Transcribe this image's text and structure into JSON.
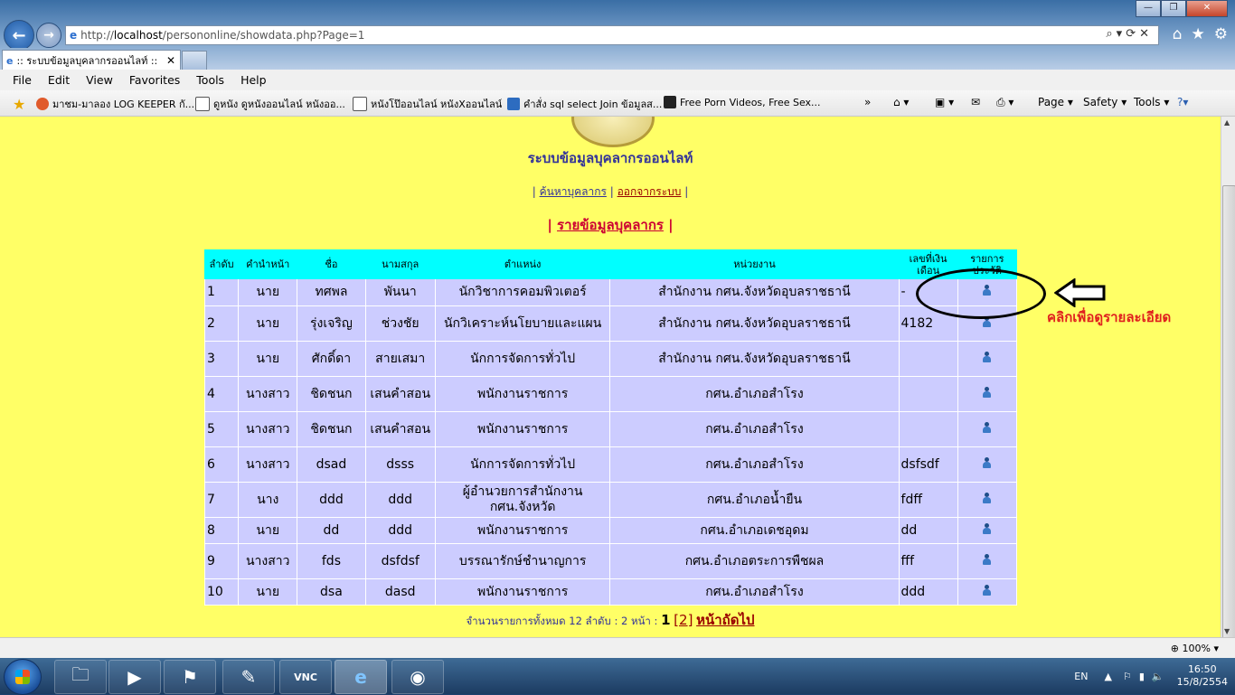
{
  "browser": {
    "url_prefix": "http://",
    "url_host": "localhost",
    "url_path": "/persononline/showdata.php?Page=1",
    "tab_title": ":: ระบบข้อมูลบุคลากรออนไลท์ ::",
    "menu": [
      "File",
      "Edit",
      "View",
      "Favorites",
      "Tools",
      "Help"
    ],
    "favorites": [
      "มาชม-มาลอง LOG KEEPER กั...",
      "ดูหนัง ดูหนังออนไลน์ หนังออ...",
      "หนังโป๊ออนไลน์ หนังXออนไลน์",
      "คำสั่ง sql select Join ข้อมูลส...",
      "Free Porn Videos, Free Sex..."
    ],
    "commands": {
      "page": "Page",
      "safety": "Safety",
      "tools": "Tools"
    },
    "zoom": "100%"
  },
  "page": {
    "site_title": "ระบบข้อมูลบุคลากรออนไลท์",
    "nav_search": "ค้นหาบุคลากร",
    "nav_logout": "ออกจากระบบ",
    "section_title": "รายข้อมูลบุคลากร",
    "table": {
      "headers": [
        "ลำดับ",
        "คำนำหน้า",
        "ชื่อ",
        "นามสกุล",
        "ตำแหน่ง",
        "หน่วยงาน",
        "เลขที่เงินเดือน",
        "รายการประวัติ"
      ],
      "rows": [
        [
          "1",
          "นาย",
          "ทศพล",
          "พันนา",
          "นักวิชาการคอมพิวเตอร์",
          "สำนักงาน กศน.จังหวัดอุบลราชธานี",
          "-"
        ],
        [
          "2",
          "นาย",
          "รุ่งเจริญ",
          "ช่วงชัย",
          "นักวิเคราะห์นโยบายและแผน",
          "สำนักงาน กศน.จังหวัดอุบลราชธานี",
          "4182"
        ],
        [
          "3",
          "นาย",
          "ศักดิ์ดา",
          "สายเสมา",
          "นักการจัดการทั่วไป",
          "สำนักงาน กศน.จังหวัดอุบลราชธานี",
          ""
        ],
        [
          "4",
          "นางสาว",
          "ชิดชนก",
          "เสนคำสอน",
          "พนักงานราชการ",
          "กศน.อำเภอสำโรง",
          ""
        ],
        [
          "5",
          "นางสาว",
          "ชิดชนก",
          "เสนคำสอน",
          "พนักงานราชการ",
          "กศน.อำเภอสำโรง",
          ""
        ],
        [
          "6",
          "นางสาว",
          "dsad",
          "dsss",
          "นักการจัดการทั่วไป",
          "กศน.อำเภอสำโรง",
          "dsfsdf"
        ],
        [
          "7",
          "นาง",
          "ddd",
          "ddd",
          "ผู้อำนวยการสำนักงาน กศน.จังหวัด",
          "กศน.อำเภอน้ำยืน",
          "fdff"
        ],
        [
          "8",
          "นาย",
          "dd",
          "ddd",
          "พนักงานราชการ",
          "กศน.อำเภอเดชอุดม",
          "dd"
        ],
        [
          "9",
          "นางสาว",
          "fds",
          "dsfdsf",
          "บรรณารักษ์ชำนาญการ",
          "กศน.อำเภอตระการพืชผล",
          "fff"
        ],
        [
          "10",
          "นาย",
          "dsa",
          "dasd",
          "พนักงานราชการ",
          "กศน.อำเภอสำโรง",
          "ddd"
        ]
      ]
    },
    "pager": {
      "summary": "จำนวนรายการทั้งหมด 12 ลำดับ : 2 หน้า :",
      "current": "1",
      "page2": "2",
      "next": "หน้าถัดไป"
    },
    "annotation": "คลิกเพื่อดูรายละเอียด"
  },
  "taskbar": {
    "lang": "EN",
    "time": "16:50",
    "date": "15/8/2554"
  },
  "colors": {
    "page_bg": "#ffff66",
    "header_bg": "#00ffff",
    "row_bg": "#ccccff",
    "title_color": "#333399",
    "section_color": "#cc0033"
  }
}
